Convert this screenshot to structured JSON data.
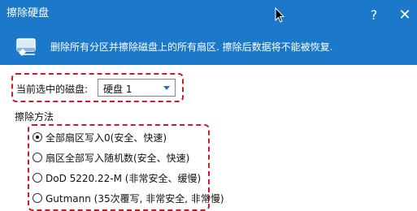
{
  "window": {
    "title": "擦除硬盘",
    "help_glyph": "?",
    "close_glyph": "✕"
  },
  "header": {
    "icon": "eraser-icon",
    "description": "删除所有分区并擦除磁盘上的所有扇区. 擦除后数据将不能被恢复."
  },
  "disk": {
    "label": "当前选中的磁盘:",
    "selected": "硬盘 1"
  },
  "wipe": {
    "heading": "擦除方法",
    "options": [
      {
        "label": "全部扇区写入0(安全、快速)",
        "checked": true
      },
      {
        "label": "扇区全部写入随机数(安全、快速)",
        "checked": false
      },
      {
        "label": "DoD 5220.22-M (非常安全、缓慢)",
        "checked": false
      },
      {
        "label": "Gutmann (35次覆写, 非常安全, 非常慢)",
        "checked": false
      }
    ]
  },
  "colors": {
    "titlebar": "#1c78c9",
    "highlight_border": "#d1182b"
  }
}
